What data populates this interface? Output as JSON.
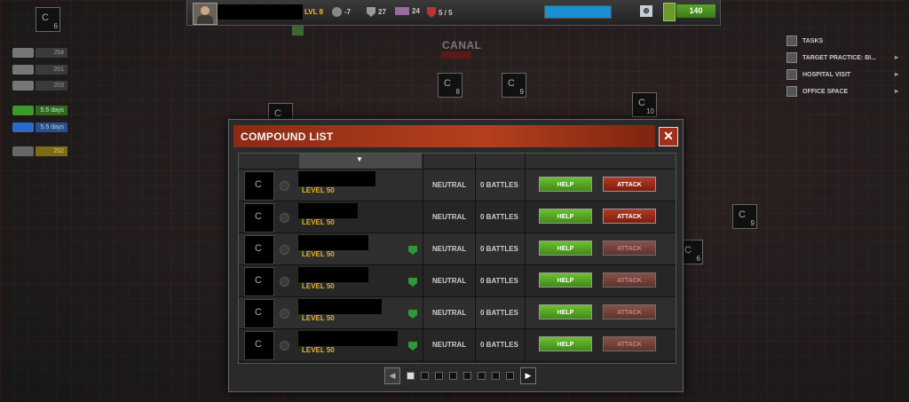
{
  "map": {
    "district_label": "CANAL",
    "markers": [
      {
        "num": "6"
      },
      {
        "num": "8"
      },
      {
        "num": "9"
      },
      {
        "num": "10"
      },
      {
        "num": "9"
      },
      {
        "num": "6"
      },
      {
        "num": ""
      }
    ]
  },
  "hud": {
    "level": "LVL 8",
    "stat1": "-7",
    "defense": "27",
    "items": "24",
    "shields": "5 / 5",
    "cash": "140",
    "colors": {
      "xp": "#1a8fd1",
      "cash": "#4a8f20"
    }
  },
  "resources": [
    {
      "value": "2bit",
      "style": ""
    },
    {
      "value": "201",
      "style": ""
    },
    {
      "value": "203",
      "style": ""
    },
    {
      "value": "5.5 days",
      "style": "green"
    },
    {
      "value": "5.5 days",
      "style": "blue"
    },
    {
      "value": "202",
      "style": "gold"
    }
  ],
  "tasks": [
    {
      "label": "TASKS"
    },
    {
      "label": "TARGET PRACTICE: BI..."
    },
    {
      "label": "HOSPITAL VISIT"
    },
    {
      "label": "OFFICE SPACE"
    }
  ],
  "dialog": {
    "title": "COMPOUND LIST",
    "close": "✕",
    "rows": [
      {
        "level": "LEVEL 50",
        "status": "NEUTRAL",
        "battles": "0 BATTLES",
        "help": "HELP",
        "attack": "ATTACK"
      },
      {
        "level": "LEVEL 50",
        "status": "NEUTRAL",
        "battles": "0 BATTLES",
        "help": "HELP",
        "attack": "ATTACK"
      },
      {
        "level": "LEVEL 50",
        "status": "NEUTRAL",
        "battles": "0 BATTLES",
        "help": "HELP",
        "attack": "ATTACK"
      },
      {
        "level": "LEVEL 50",
        "status": "NEUTRAL",
        "battles": "0 BATTLES",
        "help": "HELP",
        "attack": "ATTACK"
      },
      {
        "level": "LEVEL 50",
        "status": "NEUTRAL",
        "battles": "0 BATTLES",
        "help": "HELP",
        "attack": "ATTACK"
      },
      {
        "level": "LEVEL 50",
        "status": "NEUTRAL",
        "battles": "0 BATTLES",
        "help": "HELP",
        "attack": "ATTACK"
      }
    ],
    "sort_arrow": "▼",
    "pager": {
      "prev": "◀",
      "next": "▶",
      "current_page": 1,
      "page_count": 8
    }
  }
}
